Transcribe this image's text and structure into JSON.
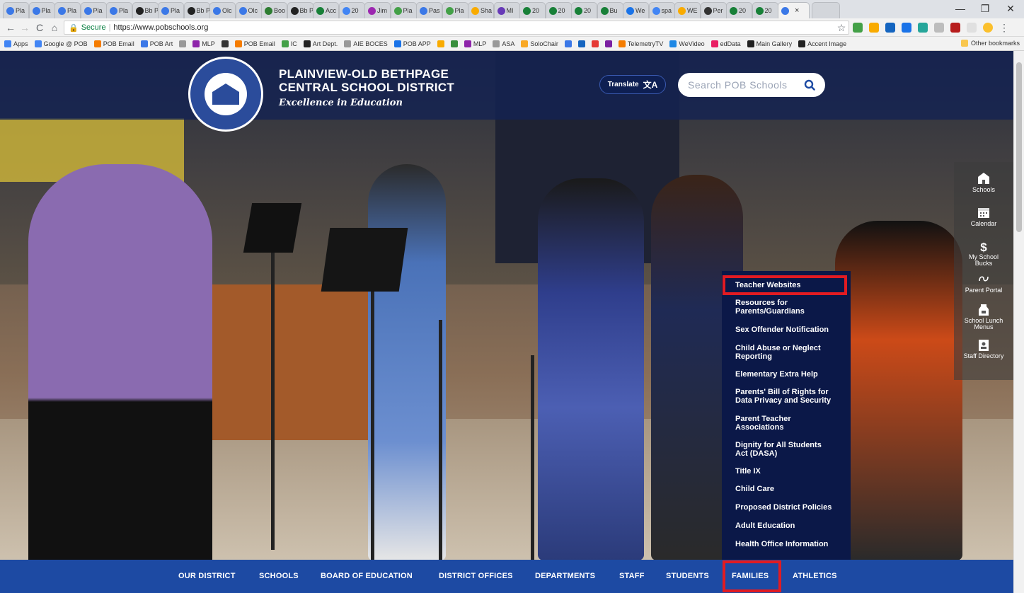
{
  "browser": {
    "tabs": [
      {
        "label": "Pla",
        "color": "#3b78e7"
      },
      {
        "label": "Pla",
        "color": "#3b78e7"
      },
      {
        "label": "Pla",
        "color": "#3b78e7"
      },
      {
        "label": "Pla",
        "color": "#3b78e7"
      },
      {
        "label": "Pla",
        "color": "#3b78e7"
      },
      {
        "label": "Bb Pla",
        "color": "#222222"
      },
      {
        "label": "Pla",
        "color": "#3b78e7"
      },
      {
        "label": "Bb Pla",
        "color": "#222222"
      },
      {
        "label": "Olc",
        "color": "#3b78e7"
      },
      {
        "label": "Olc",
        "color": "#3b78e7"
      },
      {
        "label": "Boo",
        "color": "#2e7d32"
      },
      {
        "label": "Bb Pla",
        "color": "#222222"
      },
      {
        "label": "Acc",
        "color": "#188038"
      },
      {
        "label": "20",
        "color": "#4285f4"
      },
      {
        "label": "Jim",
        "color": "#9c27b0"
      },
      {
        "label": "Pla",
        "color": "#43a047"
      },
      {
        "label": "Pas",
        "color": "#3b78e7"
      },
      {
        "label": "Pla",
        "color": "#43a047"
      },
      {
        "label": "Sha",
        "color": "#f9ab00"
      },
      {
        "label": "MI",
        "color": "#673ab7"
      },
      {
        "label": "20",
        "color": "#188038"
      },
      {
        "label": "20",
        "color": "#188038"
      },
      {
        "label": "20",
        "color": "#188038"
      },
      {
        "label": "Bu",
        "color": "#188038"
      },
      {
        "label": "We",
        "color": "#1a73e8"
      },
      {
        "label": "spa",
        "color": "#4285f4"
      },
      {
        "label": "WE",
        "color": "#f9ab00"
      },
      {
        "label": "Per",
        "color": "#333333"
      },
      {
        "label": "20",
        "color": "#188038"
      },
      {
        "label": "20",
        "color": "#188038"
      }
    ],
    "active_tab_close": "×",
    "window_controls": {
      "minimize": "—",
      "maximize": "❐",
      "close": "✕"
    },
    "nav": {
      "back": "←",
      "forward": "→",
      "reload": "C",
      "home": "⌂"
    },
    "address": {
      "secure_label": "Secure",
      "url": "https://www.pobschools.org",
      "star": "☆"
    },
    "bookmarks": [
      {
        "label": "Apps",
        "color": "#4285f4"
      },
      {
        "label": "Google @ POB",
        "color": "#4285f4"
      },
      {
        "label": "POB Email",
        "color": "#f57c00"
      },
      {
        "label": "POB Art",
        "color": "#3b78e7"
      },
      {
        "label": "",
        "color": "#999999"
      },
      {
        "label": "MLP",
        "color": "#8e24aa"
      },
      {
        "label": "",
        "color": "#333333"
      },
      {
        "label": "POB Email",
        "color": "#f57c00"
      },
      {
        "label": "IC",
        "color": "#43a047"
      },
      {
        "label": "Art Dept.",
        "color": "#222222"
      },
      {
        "label": "AIE BOCES",
        "color": "#999999"
      },
      {
        "label": "POB APP",
        "color": "#1a73e8"
      },
      {
        "label": "",
        "color": "#f9ab00"
      },
      {
        "label": "",
        "color": "#388e3c"
      },
      {
        "label": "MLP",
        "color": "#8e24aa"
      },
      {
        "label": "ASA",
        "color": "#999999"
      },
      {
        "label": "SoloChair",
        "color": "#f9a825"
      },
      {
        "label": "",
        "color": "#3b78e7"
      },
      {
        "label": "",
        "color": "#1565c0"
      },
      {
        "label": "",
        "color": "#e53935"
      },
      {
        "label": "",
        "color": "#7b1fa2"
      },
      {
        "label": "TelemetryTV",
        "color": "#f57c00"
      },
      {
        "label": "WeVideo",
        "color": "#1e88e5"
      },
      {
        "label": "edData",
        "color": "#e91e63"
      },
      {
        "label": "Main Gallery",
        "color": "#222222"
      },
      {
        "label": "Accent Image",
        "color": "#222222"
      }
    ],
    "other_bookmarks": "Other bookmarks"
  },
  "site": {
    "district_line1": "PLAINVIEW-OLD BETHPAGE",
    "district_line2": "CENTRAL SCHOOL DISTRICT",
    "tagline": "Excellence in Education",
    "translate_label": "Translate",
    "search_placeholder": "Search POB Schools"
  },
  "quick_links": [
    {
      "label": "Schools",
      "icon": "school-icon"
    },
    {
      "label": "Calendar",
      "icon": "calendar-icon"
    },
    {
      "label": "My School Bucks",
      "icon": "dollar-icon"
    },
    {
      "label": "Parent Portal",
      "icon": "portal-icon"
    },
    {
      "label": "School Lunch Menus",
      "icon": "milk-carton-icon"
    },
    {
      "label": "Staff Directory",
      "icon": "directory-icon"
    }
  ],
  "families_menu": [
    {
      "line1": "Teacher Websites",
      "line2": ""
    },
    {
      "line1": "Resources for",
      "line2": "Parents/Guardians"
    },
    {
      "line1": "Sex Offender Notification",
      "line2": ""
    },
    {
      "line1": "Child Abuse or Neglect",
      "line2": "Reporting"
    },
    {
      "line1": "Elementary Extra Help",
      "line2": ""
    },
    {
      "line1": "Parents' Bill of Rights for",
      "line2": "Data Privacy and Security"
    },
    {
      "line1": "Parent Teacher",
      "line2": "Associations"
    },
    {
      "line1": "Dignity for All Students",
      "line2": "Act (DASA)"
    },
    {
      "line1": "Title IX",
      "line2": ""
    },
    {
      "line1": "Child Care",
      "line2": ""
    },
    {
      "line1": "Proposed District Policies",
      "line2": ""
    },
    {
      "line1": "Adult Education",
      "line2": ""
    },
    {
      "line1": "Health Office Information",
      "line2": ""
    }
  ],
  "main_nav": [
    "OUR DISTRICT",
    "SCHOOLS",
    "BOARD OF EDUCATION",
    "DISTRICT OFFICES",
    "DEPARTMENTS",
    "STAFF",
    "STUDENTS",
    "FAMILIES",
    "ATHLETICS"
  ],
  "colors": {
    "header_bg": "#142252",
    "nav_bg": "#1d4aa3",
    "dropdown_bg": "#0b1848",
    "highlight": "#e11b22"
  }
}
